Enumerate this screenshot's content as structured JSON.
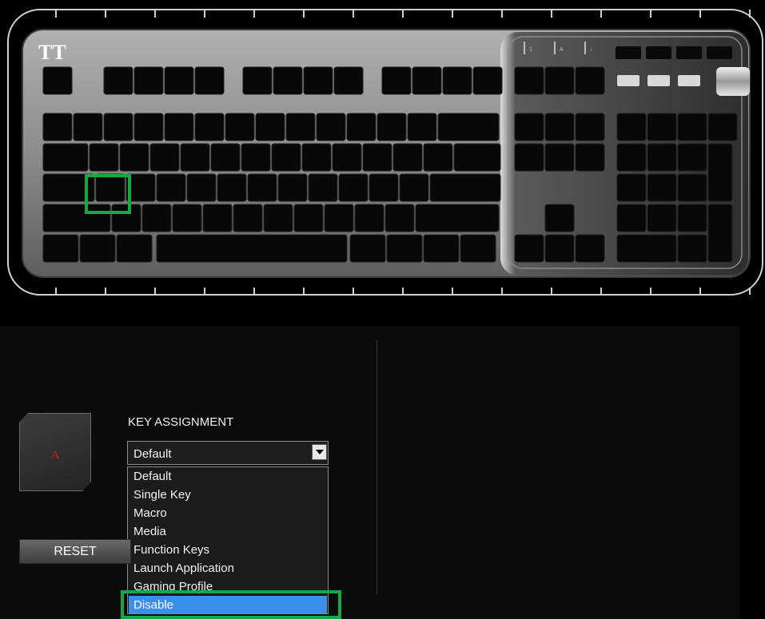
{
  "keyboard": {
    "brand_logo_text": "TT",
    "led_labels": [
      "1",
      "A",
      "↓"
    ]
  },
  "key_preview": {
    "letter": "A"
  },
  "assignment": {
    "label": "KEY ASSIGNMENT",
    "selected_value": "Default",
    "options": [
      "Default",
      "Single Key",
      "Macro",
      "Media",
      "Function Keys",
      "Launch Application",
      "Gaming Profile",
      "Disable"
    ],
    "highlighted_option": "Disable"
  },
  "buttons": {
    "reset_label": "RESET"
  },
  "colors": {
    "highlight_green": "#15a84a",
    "selection_blue": "#3b8fea",
    "key_letter_red": "#e01818"
  }
}
